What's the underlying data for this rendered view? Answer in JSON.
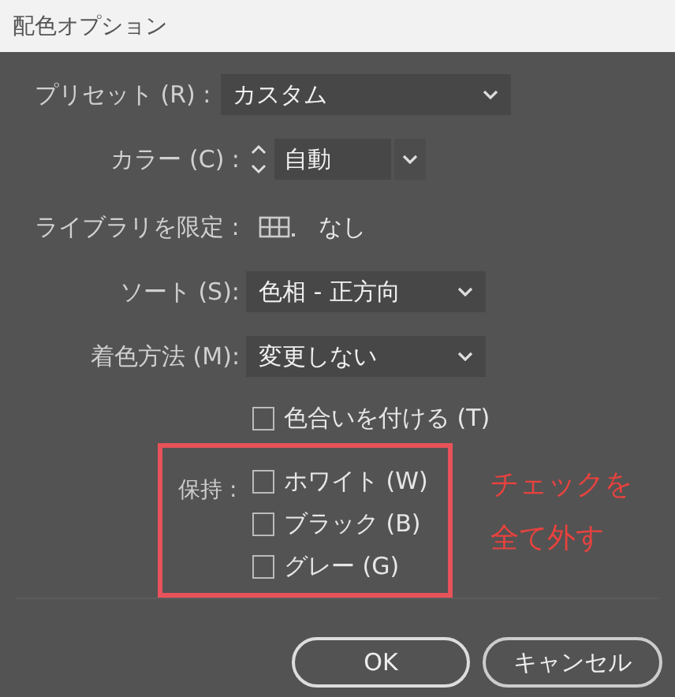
{
  "window": {
    "title": "配色オプション"
  },
  "preset": {
    "label": "プリセット (R) :",
    "value": "カスタム"
  },
  "color": {
    "label": "カラー (C) :",
    "value": "自動"
  },
  "library": {
    "label": "ライブラリを限定 :",
    "value": "なし"
  },
  "sort": {
    "label": "ソート (S):",
    "value": "色相 - 正方向"
  },
  "coloring_method": {
    "label": "着色方法 (M):",
    "value": "変更しない"
  },
  "tint": {
    "label": "色合いを付ける (T)",
    "checked": false
  },
  "preserve": {
    "label": "保持 :",
    "options": [
      {
        "label": "ホワイト (W)",
        "checked": false
      },
      {
        "label": "ブラック (B)",
        "checked": false
      },
      {
        "label": "グレー (G)",
        "checked": false
      }
    ]
  },
  "annotation": {
    "lines": [
      "チェックを",
      "全て外す"
    ]
  },
  "buttons": [
    {
      "label": "OK"
    },
    {
      "label": "キャンセル"
    }
  ]
}
